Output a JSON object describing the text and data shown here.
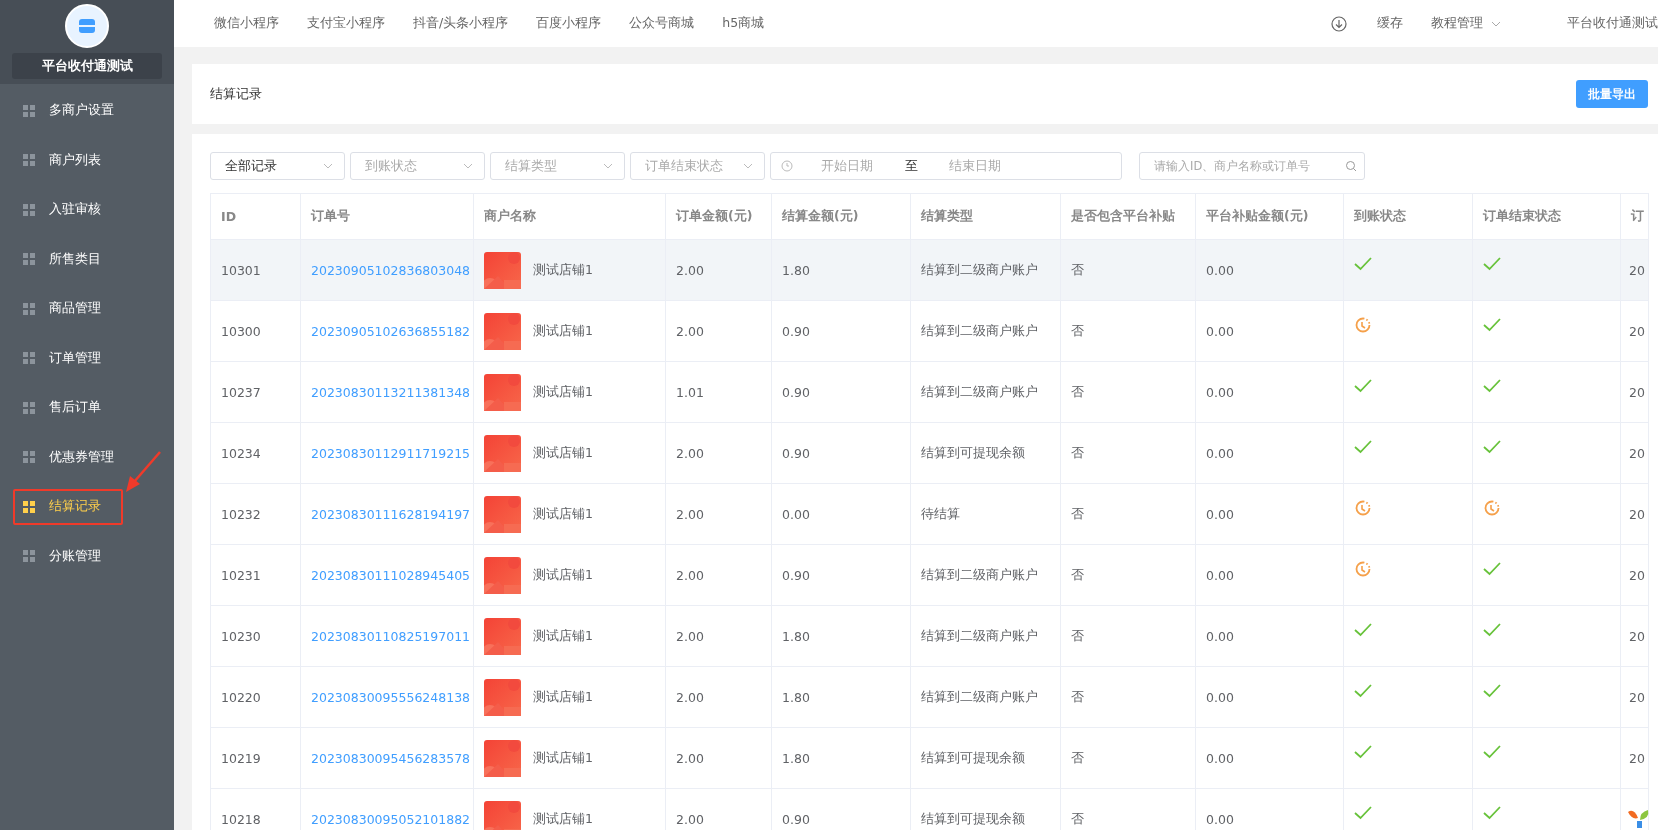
{
  "sidebar": {
    "shop_name": "平台收付通测试",
    "items": [
      {
        "label": "多商户设置",
        "selected": false
      },
      {
        "label": "商户列表",
        "selected": false
      },
      {
        "label": "入驻审核",
        "selected": false
      },
      {
        "label": "所售类目",
        "selected": false
      },
      {
        "label": "商品管理",
        "selected": false
      },
      {
        "label": "订单管理",
        "selected": false
      },
      {
        "label": "售后订单",
        "selected": false
      },
      {
        "label": "优惠券管理",
        "selected": false
      },
      {
        "label": "结算记录",
        "selected": true
      },
      {
        "label": "分账管理",
        "selected": false
      }
    ]
  },
  "top_nav": {
    "links": [
      "微信小程序",
      "支付宝小程序",
      "抖音/头条小程序",
      "百度小程序",
      "公众号商城",
      "h5商城"
    ],
    "cache": "缓存",
    "tutorial": "教程管理",
    "account": "平台收付通测试"
  },
  "page": {
    "title": "结算记录",
    "export_button": "批量导出"
  },
  "filters": {
    "record_select": "全部记录",
    "arrival_placeholder": "到账状态",
    "type_placeholder": "结算类型",
    "end_placeholder": "订单结束状态",
    "start_placeholder": "开始日期",
    "range_separator": "至",
    "end_date_placeholder": "结束日期",
    "search_placeholder": "请输入ID、商户名称或订单号"
  },
  "table": {
    "columns": [
      "ID",
      "订单号",
      "商户名称",
      "订单金额(元)",
      "结算金额(元)",
      "结算类型",
      "是否包含平台补贴",
      "平台补贴金额(元)",
      "到账状态",
      "订单结束状态",
      "订"
    ],
    "rows": [
      {
        "id": "10301",
        "order_no": "20230905102836803048",
        "shop": "测试店铺1",
        "order_amount": "2.00",
        "settle_amount": "1.80",
        "settle_type": "结算到二级商户账户",
        "subsidy": "否",
        "subsidy_amount": "0.00",
        "arrived": true,
        "finished": true,
        "column_11": "20",
        "highlighted": true
      },
      {
        "id": "10300",
        "order_no": "20230905102636855182",
        "shop": "测试店铺1",
        "order_amount": "2.00",
        "settle_amount": "0.90",
        "settle_type": "结算到二级商户账户",
        "subsidy": "否",
        "subsidy_amount": "0.00",
        "arrived": false,
        "finished": true,
        "column_11": "20",
        "highlighted": false
      },
      {
        "id": "10237",
        "order_no": "20230830113211381348",
        "shop": "测试店铺1",
        "order_amount": "1.01",
        "settle_amount": "0.90",
        "settle_type": "结算到二级商户账户",
        "subsidy": "否",
        "subsidy_amount": "0.00",
        "arrived": true,
        "finished": true,
        "column_11": "20",
        "highlighted": false
      },
      {
        "id": "10234",
        "order_no": "20230830112911719215",
        "shop": "测试店铺1",
        "order_amount": "2.00",
        "settle_amount": "0.90",
        "settle_type": "结算到可提现余额",
        "subsidy": "否",
        "subsidy_amount": "0.00",
        "arrived": true,
        "finished": true,
        "column_11": "20",
        "highlighted": false
      },
      {
        "id": "10232",
        "order_no": "20230830111628194197",
        "shop": "测试店铺1",
        "order_amount": "2.00",
        "settle_amount": "0.00",
        "settle_type": "待结算",
        "subsidy": "否",
        "subsidy_amount": "0.00",
        "arrived": false,
        "finished": false,
        "column_11": "20",
        "highlighted": false
      },
      {
        "id": "10231",
        "order_no": "20230830111028945405",
        "shop": "测试店铺1",
        "order_amount": "2.00",
        "settle_amount": "0.90",
        "settle_type": "结算到二级商户账户",
        "subsidy": "否",
        "subsidy_amount": "0.00",
        "arrived": false,
        "finished": true,
        "column_11": "20",
        "highlighted": false
      },
      {
        "id": "10230",
        "order_no": "20230830110825197011",
        "shop": "测试店铺1",
        "order_amount": "2.00",
        "settle_amount": "1.80",
        "settle_type": "结算到二级商户账户",
        "subsidy": "否",
        "subsidy_amount": "0.00",
        "arrived": true,
        "finished": true,
        "column_11": "20",
        "highlighted": false
      },
      {
        "id": "10220",
        "order_no": "20230830095556248138",
        "shop": "测试店铺1",
        "order_amount": "2.00",
        "settle_amount": "1.80",
        "settle_type": "结算到二级商户账户",
        "subsidy": "否",
        "subsidy_amount": "0.00",
        "arrived": true,
        "finished": true,
        "column_11": "20",
        "highlighted": false
      },
      {
        "id": "10219",
        "order_no": "20230830095456283578",
        "shop": "测试店铺1",
        "order_amount": "2.00",
        "settle_amount": "1.80",
        "settle_type": "结算到可提现余额",
        "subsidy": "否",
        "subsidy_amount": "0.00",
        "arrived": true,
        "finished": true,
        "column_11": "20",
        "highlighted": false
      },
      {
        "id": "10218",
        "order_no": "20230830095052101882",
        "shop": "测试店铺1",
        "order_amount": "2.00",
        "settle_amount": "0.90",
        "settle_type": "结算到可提现余额",
        "subsidy": "否",
        "subsidy_amount": "0.00",
        "arrived": true,
        "finished": true,
        "highlighted": false
      }
    ]
  }
}
